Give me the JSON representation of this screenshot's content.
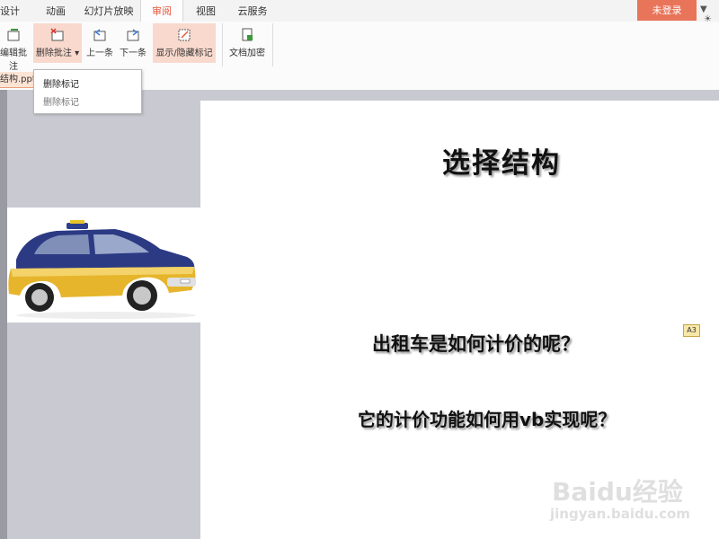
{
  "tabs": [
    {
      "label": "设计"
    },
    {
      "label": "动画"
    },
    {
      "label": "幻灯片放映"
    },
    {
      "label": "审阅"
    },
    {
      "label": "视图"
    },
    {
      "label": "云服务"
    }
  ],
  "login_label": "未登录",
  "ribbon": {
    "edit_comment": "编辑批注",
    "delete_comment": "删除批注",
    "prev": "上一条",
    "next": "下一条",
    "show_hide_markup": "显示/隐藏标记",
    "encrypt": "文档加密"
  },
  "doc_tab": "结构.ppt",
  "dropdown": {
    "items": [
      "删除标记",
      "删除标记"
    ]
  },
  "slide": {
    "title": "选择结构",
    "line1": "出租车是如何计价的呢？",
    "line2": "它的计价功能如何用vb实现呢？",
    "comment_marker": "A3"
  },
  "watermark": {
    "line1": "Baidu经验",
    "line2": "jingyan.baidu.com"
  }
}
